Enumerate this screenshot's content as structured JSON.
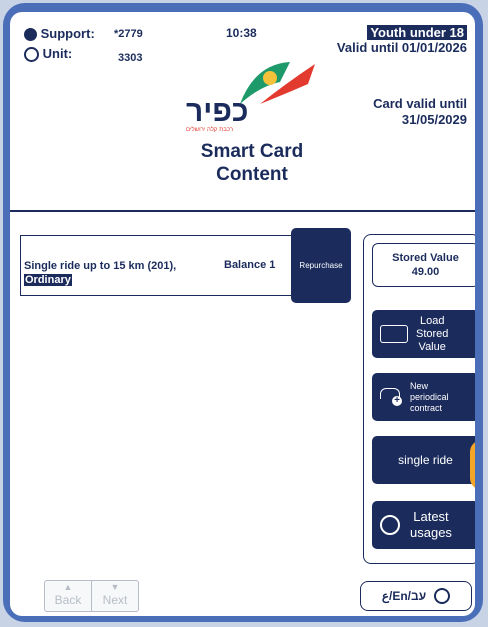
{
  "header": {
    "support_label": "Support:",
    "support_value": "*2779",
    "unit_label": "Unit:",
    "unit_value": "3303",
    "time": "10:38",
    "profile_highlight": "Youth under 18",
    "profile_valid": "Valid until 01/01/2026",
    "card_valid_label": "Card valid until",
    "card_valid_date": "31/05/2029"
  },
  "logo": {
    "text": "כפיר",
    "subtext": "רכבת קלה ירושלים"
  },
  "title": {
    "line1": "Smart Card",
    "line2": "Content"
  },
  "contract": {
    "line1": "Single ride up to 15 km (201),",
    "line2": "Ordinary",
    "balance": "Balance 1",
    "repurchase": "Repurchase"
  },
  "sidebar": {
    "stored_label": "Stored Value",
    "stored_amount": "49.00",
    "load_line1": "Load",
    "load_line2": "Stored",
    "load_line3": "Value",
    "new_line1": "New",
    "new_line2": "periodical",
    "new_line3": "contract",
    "single_ride": "single ride",
    "latest_line1": "Latest",
    "latest_line2": "usages"
  },
  "footer": {
    "back": "Back",
    "next": "Next",
    "lang": "ع/En/עב"
  }
}
